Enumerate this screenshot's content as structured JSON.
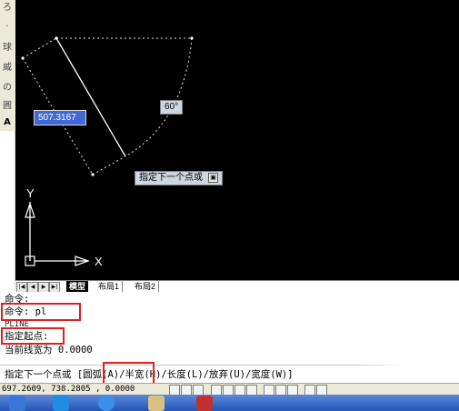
{
  "palette": {
    "glyphs": [
      "ろ",
      ".",
      "球",
      "威",
      "の",
      "圓",
      "A"
    ]
  },
  "canvas": {
    "dim_length": "507.3167",
    "angle": "60°",
    "prompt": "指定下一个点或",
    "prompt_arrow_glyph": "▣",
    "ucs_y": "Y",
    "ucs_x": "X"
  },
  "tabs": {
    "nav": [
      "|◀",
      "◀",
      "▶",
      "▶|"
    ],
    "model": "模型",
    "layout1": "布局1",
    "layout2": "布局2"
  },
  "command_history": [
    "命令:",
    "命令: pl",
    "PLINE",
    "指定起点:",
    "当前线宽为 0.0000"
  ],
  "active_command": "指定下一个点或 [圆弧(A)/半宽(H)/长度(L)/放弃(U)/宽度(W)]",
  "status": {
    "coordinates": "697.2609,  738.2805 , 0.0000"
  },
  "colors": {
    "canvas_bg": "#000000",
    "highlight_box": "#e02020",
    "input_bg": "#3d6ad6",
    "tooltip_bg": "#ced6e2"
  }
}
